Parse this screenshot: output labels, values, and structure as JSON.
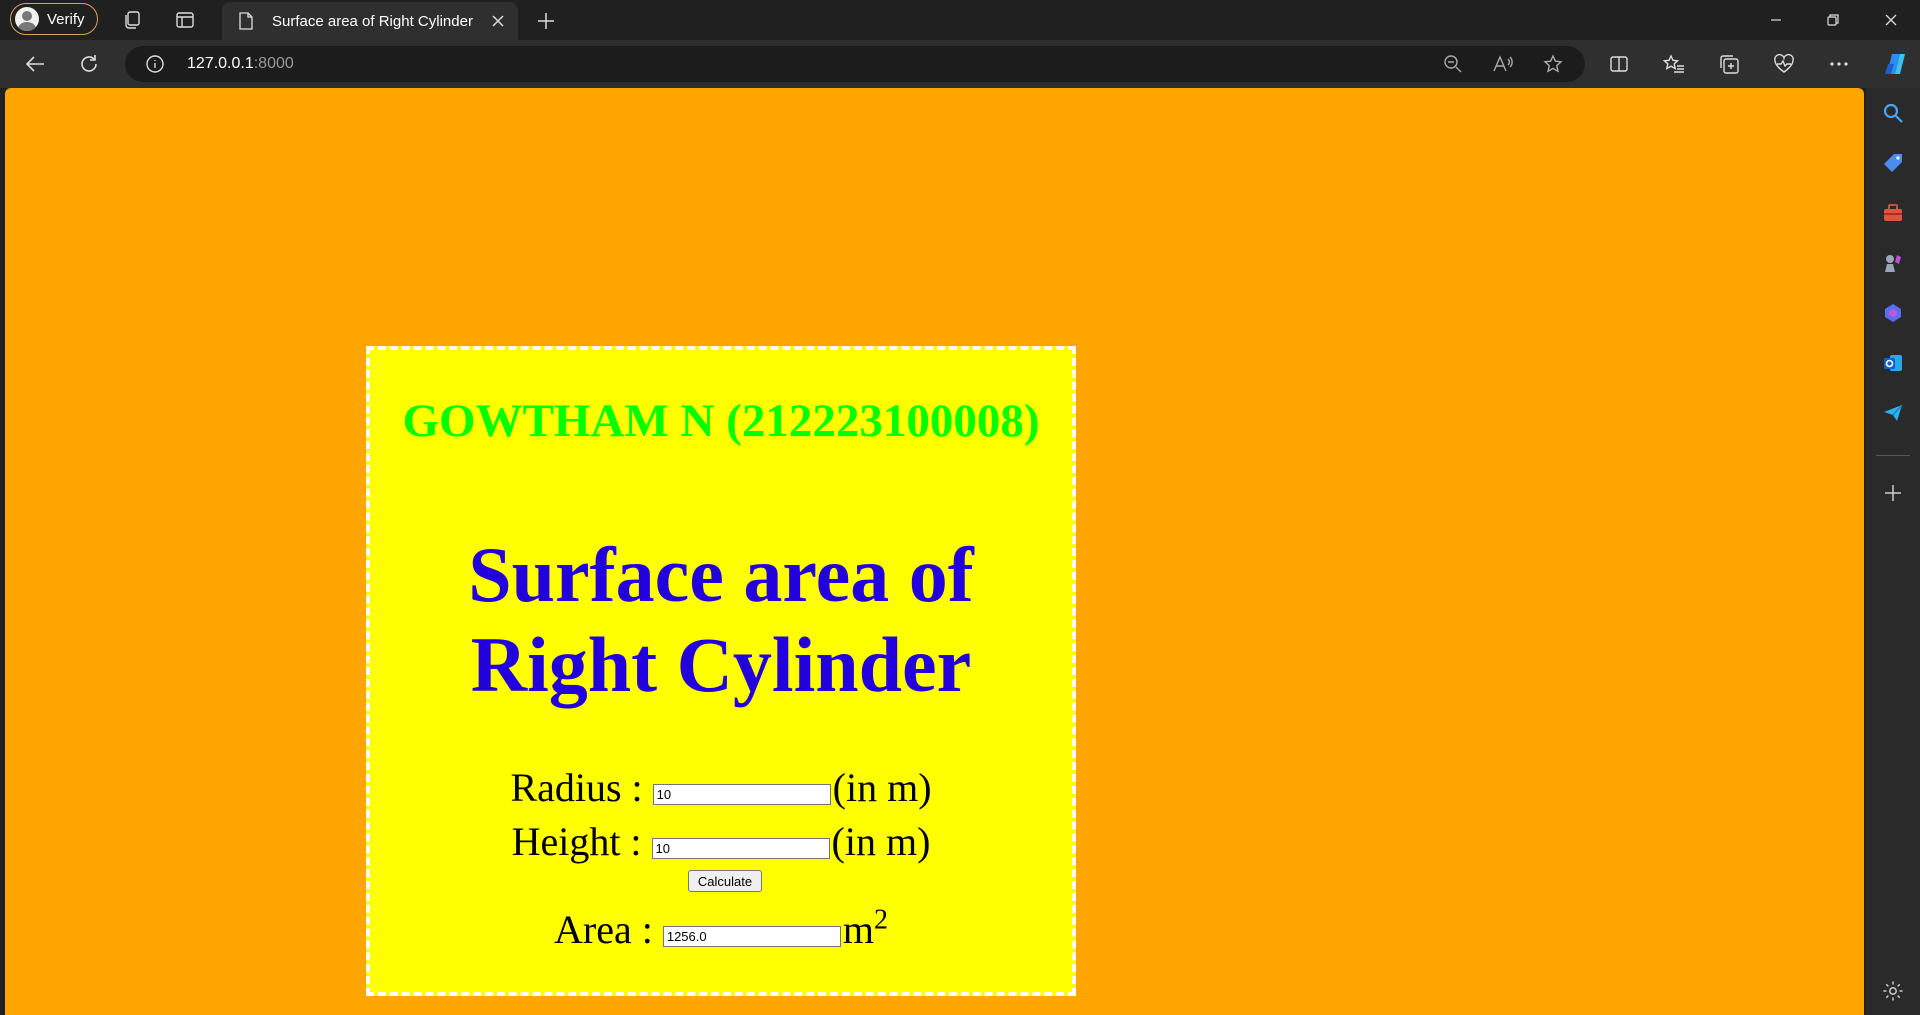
{
  "browser": {
    "profile_label": "Verify",
    "tab_title": "Surface area of Right Cylinder",
    "url_host": "127.0.0.1",
    "url_port": ":8000"
  },
  "page": {
    "student": "GOWTHAM N (212223100008)",
    "heading_line1": "Surface area of",
    "heading_line2": "Right Cylinder",
    "radius_label": "Radius :",
    "radius_value": "10",
    "radius_unit": "(in m)",
    "height_label": "Height :",
    "height_value": "10",
    "height_unit": "(in m)",
    "calculate_label": "Calculate",
    "area_label": "Area :",
    "area_value": "1256.0",
    "area_unit": "m",
    "area_unit_power": "2"
  },
  "colors": {
    "page_background": "#ffa500",
    "card_background": "#ffff00",
    "student_text": "#00ff00",
    "heading_text": "#2200dd"
  }
}
